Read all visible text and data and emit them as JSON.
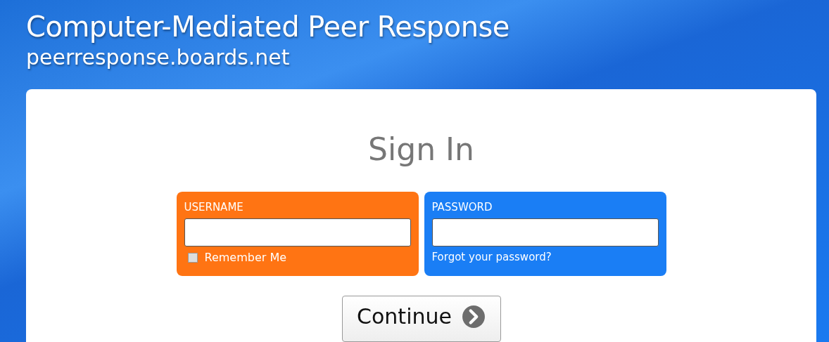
{
  "header": {
    "title": "Computer-Mediated Peer Response",
    "subtitle": "peerresponse.boards.net"
  },
  "heading": "Sign In",
  "fields": [
    {
      "label": "USERNAME",
      "color": "#ff7413",
      "kind": "checkbox",
      "option": {
        "label": "Remember Me",
        "checked": false
      }
    },
    {
      "label": "PASSWORD",
      "color": "#1a7ef5",
      "kind": "link",
      "link": "Forgot your password?"
    }
  ],
  "button": "Continue"
}
